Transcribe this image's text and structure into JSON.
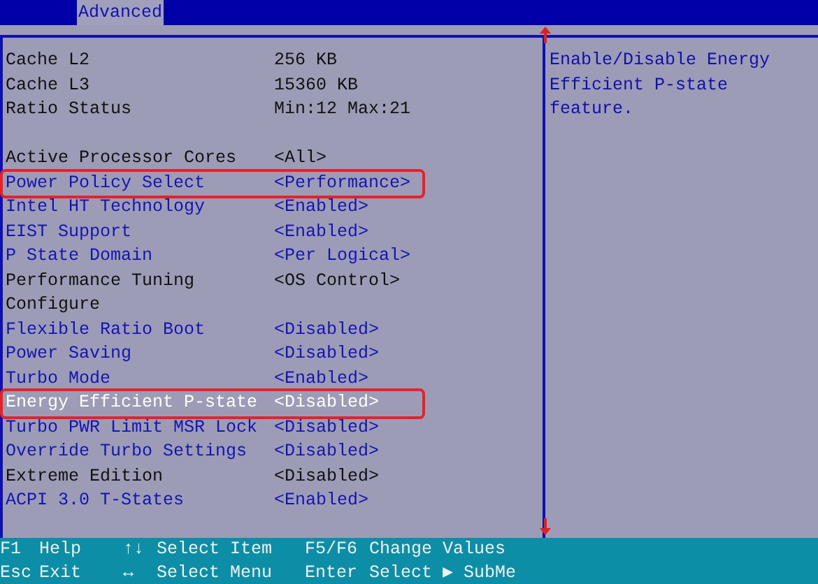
{
  "menu_bar": {
    "tabs": [
      {
        "label": "Advanced",
        "selected": true
      }
    ]
  },
  "settings": [
    {
      "kind": "info",
      "label": "Cache L2",
      "value": "256 KB",
      "selected": false,
      "annotated": false
    },
    {
      "kind": "info",
      "label": "Cache L3",
      "value": "15360 KB",
      "selected": false,
      "annotated": false
    },
    {
      "kind": "info",
      "label": "Ratio Status",
      "value": "Min:12 Max:21",
      "selected": false,
      "annotated": false
    },
    {
      "kind": "spacer"
    },
    {
      "kind": "info",
      "label": "Active Processor Cores",
      "value": "<All>",
      "selected": false,
      "annotated": false
    },
    {
      "kind": "option",
      "label": "Power Policy Select",
      "value": "<Performance>",
      "selected": false,
      "annotated": true
    },
    {
      "kind": "option",
      "label": "Intel HT Technology",
      "value": "<Enabled>",
      "selected": false,
      "annotated": false
    },
    {
      "kind": "option",
      "label": "EIST Support",
      "value": "<Enabled>",
      "selected": false,
      "annotated": false
    },
    {
      "kind": "option",
      "label": "P State Domain",
      "value": "<Per Logical>",
      "selected": false,
      "annotated": false
    },
    {
      "kind": "info",
      "label": "Performance Tuning",
      "value": "<OS Control>",
      "selected": false,
      "annotated": false
    },
    {
      "kind": "info",
      "label": "Configure",
      "selected": false,
      "annotated": false
    },
    {
      "kind": "option",
      "label": "Flexible Ratio Boot",
      "value": "<Disabled>",
      "selected": false,
      "annotated": false
    },
    {
      "kind": "option",
      "label": "Power Saving",
      "value": "<Disabled>",
      "selected": false,
      "annotated": false
    },
    {
      "kind": "option",
      "label": "Turbo Mode",
      "value": "<Enabled>",
      "selected": false,
      "annotated": false
    },
    {
      "kind": "option",
      "label": "Energy Efficient P-state",
      "value": "<Disabled>",
      "selected": true,
      "annotated": true
    },
    {
      "kind": "option",
      "label": "Turbo PWR Limit MSR Lock",
      "value": "<Disabled>",
      "selected": false,
      "annotated": false
    },
    {
      "kind": "option",
      "label": "Override Turbo Settings",
      "value": "<Disabled>",
      "selected": false,
      "annotated": false
    },
    {
      "kind": "info",
      "label": "Extreme Edition",
      "value": "<Disabled>",
      "selected": false,
      "annotated": false
    },
    {
      "kind": "option",
      "label": "ACPI 3.0 T-States",
      "value": "<Enabled>",
      "selected": false,
      "annotated": false
    }
  ],
  "help_text": "Enable/Disable Energy Efficient P-state feature.",
  "key_legend": [
    [
      {
        "key": "F1",
        "action": "Help"
      },
      {
        "key": "↑↓",
        "action": "Select Item"
      },
      {
        "key": "F5/F6",
        "action": "Change Values"
      }
    ],
    [
      {
        "key": "Esc",
        "action": "Exit"
      },
      {
        "key": "↔",
        "action": "Select Menu"
      },
      {
        "key": "Enter",
        "action": "Select ▶ SubMe"
      }
    ]
  ]
}
